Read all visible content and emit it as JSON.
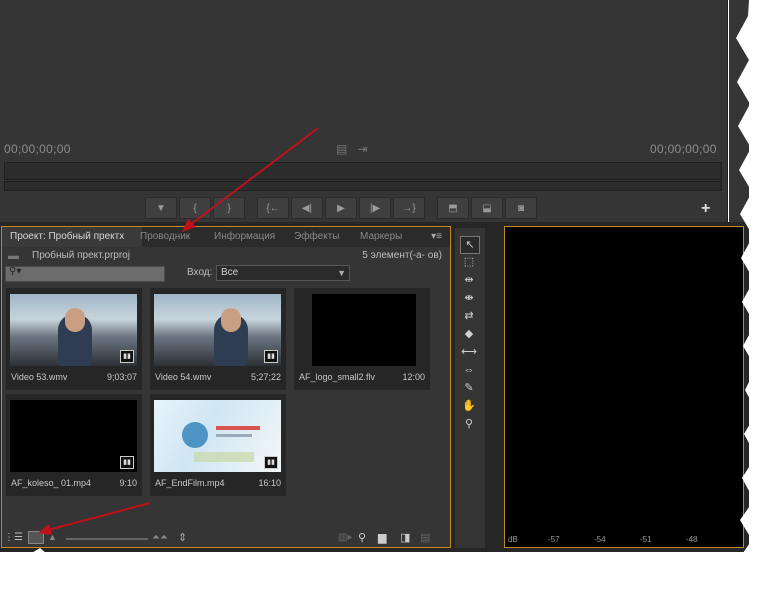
{
  "monitor": {
    "timecode_left": "00;00;00;00",
    "timecode_right": "00;00;00;00",
    "plus_label": "+"
  },
  "tabs": [
    {
      "label": "Проект: Пробный пректх"
    },
    {
      "label": "Проводник"
    },
    {
      "label": "Информация"
    },
    {
      "label": "Эффекты"
    },
    {
      "label": "Маркеры"
    }
  ],
  "project": {
    "file_name": "Пробный пpект.prproj",
    "count": "5 элемент(-а- ов)",
    "input_label": "Вход:",
    "input_value": "Все"
  },
  "items": [
    {
      "name": "Video 53.wmv",
      "duration": "9;03;07"
    },
    {
      "name": "Video 54.wmv",
      "duration": "5;27;22"
    },
    {
      "name": "AF_logo_small2.flv",
      "duration": "12:00"
    },
    {
      "name": "AF_koleso_ 01.mp4",
      "duration": "9:10"
    },
    {
      "name": "AF_EndFilm.mp4",
      "duration": "16:10"
    }
  ],
  "meter": {
    "labels": [
      "dB",
      "-57",
      "-54",
      "-51",
      "-48"
    ]
  },
  "colors": {
    "panel_focus_border": "#c48a1f",
    "annotation_arrow": "#c0111b"
  }
}
